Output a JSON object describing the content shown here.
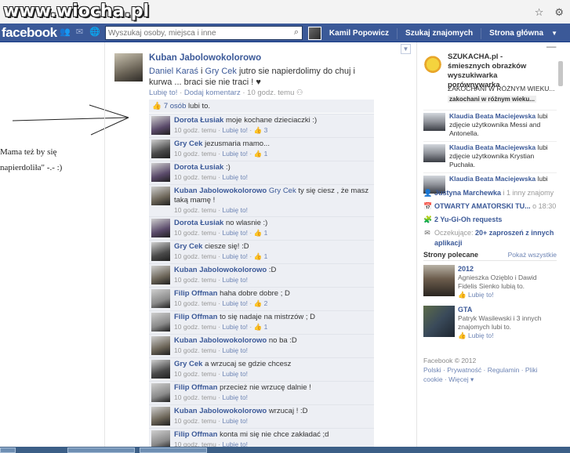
{
  "watermark": "www.wiocha.pl",
  "facebook_bar": {
    "logo": "facebook",
    "search_placeholder": "Wyszukaj osoby, miejsca i inne",
    "user_name": "Kamil Popowicz",
    "find_friends": "Szukaj znajomych",
    "home": "Strona główna"
  },
  "annotation": {
    "line1": "Mama też by się",
    "line2": "napierdoliła\" -.- :)"
  },
  "post": {
    "author": "Kuban Jabolowokolorowo",
    "tagged1": "Daniel Karaś",
    "tagged_joiner": " i ",
    "tagged2": "Gry Cek",
    "text": " jutro sie napierdolimy do chuj i kurwa ... braci sie nie traci ! ♥",
    "like_link": "Lubię to!",
    "comment_link": "Dodaj komentarz",
    "time": "10 godz. temu"
  },
  "likes": {
    "count_text": "7 osób",
    "suffix": "lubi to."
  },
  "comments": [
    {
      "author": "Dorota Łusiak",
      "text": "moje kochane dzieciaczki :)",
      "time": "10 godz. temu",
      "like": "Lubię to!",
      "likes": "3",
      "avatar": "#5a4a6a"
    },
    {
      "author": "Gry Cek",
      "text": "jezusmaria mamo...",
      "time": "10 godz. temu",
      "like": "Lubię to!",
      "likes": "1",
      "avatar": "#4a4a4a"
    },
    {
      "author": "Dorota Łusiak",
      "text": ":)",
      "time": "10 godz. temu",
      "like": "Lubię to!",
      "likes": "",
      "avatar": "#5a4a6a"
    },
    {
      "author": "Kuban Jabolowokolorowo",
      "tag": "Gry Cek",
      "text": " ty się ciesz , że masz taką mamę !",
      "time": "10 godz. temu",
      "like": "Lubię to!",
      "likes": "",
      "avatar": "#6b6457"
    },
    {
      "author": "Dorota Łusiak",
      "text": "no wlasnie :)",
      "time": "10 godz. temu",
      "like": "Lubię to!",
      "likes": "1",
      "avatar": "#5a4a6a"
    },
    {
      "author": "Gry Cek",
      "text": "ciesze się! :D",
      "time": "10 godz. temu",
      "like": "Lubię to!",
      "likes": "1",
      "avatar": "#4a4a4a"
    },
    {
      "author": "Kuban Jabolowokolorowo",
      "text": ":D",
      "time": "10 godz. temu",
      "like": "Lubię to!",
      "likes": "",
      "avatar": "#6b6457"
    },
    {
      "author": "Filip Offman",
      "text": "haha dobre dobre ; D",
      "time": "10 godz. temu",
      "like": "Lubię to!",
      "likes": "2",
      "avatar": "#8a8a8a"
    },
    {
      "author": "Filip Offman",
      "text": "to się nadaje na mistrzów ; D",
      "time": "10 godz. temu",
      "like": "Lubię to!",
      "likes": "1",
      "avatar": "#8a8a8a"
    },
    {
      "author": "Kuban Jabolowokolorowo",
      "text": "no ba :D",
      "time": "10 godz. temu",
      "like": "Lubię to!",
      "likes": "",
      "avatar": "#6b6457"
    },
    {
      "author": "Gry Cek",
      "text": "a wrzucaj se gdzie chcesz",
      "time": "10 godz. temu",
      "like": "Lubię to!",
      "likes": "",
      "avatar": "#4a4a4a"
    },
    {
      "author": "Filip Offman",
      "text": "przecież nie wrzucę dalnie !",
      "time": "10 godz. temu",
      "like": "Lubię to!",
      "likes": "",
      "avatar": "#8a8a8a"
    },
    {
      "author": "Kuban Jabolowokolorowo",
      "text": "wrzucaj ! :D",
      "time": "10 godz. temu",
      "like": "Lubię to!",
      "likes": "",
      "avatar": "#6b6457"
    },
    {
      "author": "Filip Offman",
      "text": "konta mi się nie chce zakładać ;d",
      "time": "10 godz. temu",
      "like": "Lubię to!",
      "likes": "",
      "avatar": "#8a8a8a"
    }
  ],
  "ad": {
    "title": "SZUKACHA.pl - śmiesznych obrazków wyszukiwarka porównywarka",
    "sub": "ZAKOCHANI W RÓŻNYM WIEKU...",
    "sub2": "zakochani w różnym wieku..."
  },
  "ticker": [
    {
      "name": "Klaudia Beata Maciejewska",
      "text": " lubi zdjęcie użytkownika Messi and Antonella."
    },
    {
      "name": "Klaudia Beata Maciejewska",
      "text": " lubi zdjęcie użytkownika Krystian Puchała."
    },
    {
      "name": "Klaudia Beata Maciejewska",
      "text": " lubi"
    }
  ],
  "notifications": [
    {
      "icon": "friend",
      "bold": "Justyna Marchewka",
      "text": " i 1 inny znajomy"
    },
    {
      "icon": "event",
      "bold": "OTWARTY AMATORSKI TU...",
      "text": " o 18:30"
    },
    {
      "icon": "app",
      "bold": "2 Yu-Gi-Oh requests",
      "text": ""
    },
    {
      "icon": "invite",
      "pre": "Oczekujące: ",
      "bold": "20+ zaproszeń z innych aplikacji",
      "text": ""
    }
  ],
  "sponsored": {
    "title": "Strony polecane",
    "all": "Pokaż wszystkie",
    "pages": [
      {
        "name": "2012",
        "desc": "Agnieszka Ozięblo i Dawid Fidelis Sienko lubią to.",
        "like": "Lubię to!"
      },
      {
        "name": "GTA",
        "desc": "Patryk Wasilewski i 3 innych znajomych lubi to.",
        "like": "Lubię to!"
      }
    ]
  },
  "footer": {
    "copy": "Facebook © 2012",
    "links": "Polski · Prywatność · Regulamin · Pliki cookie · Więcej ▾"
  }
}
